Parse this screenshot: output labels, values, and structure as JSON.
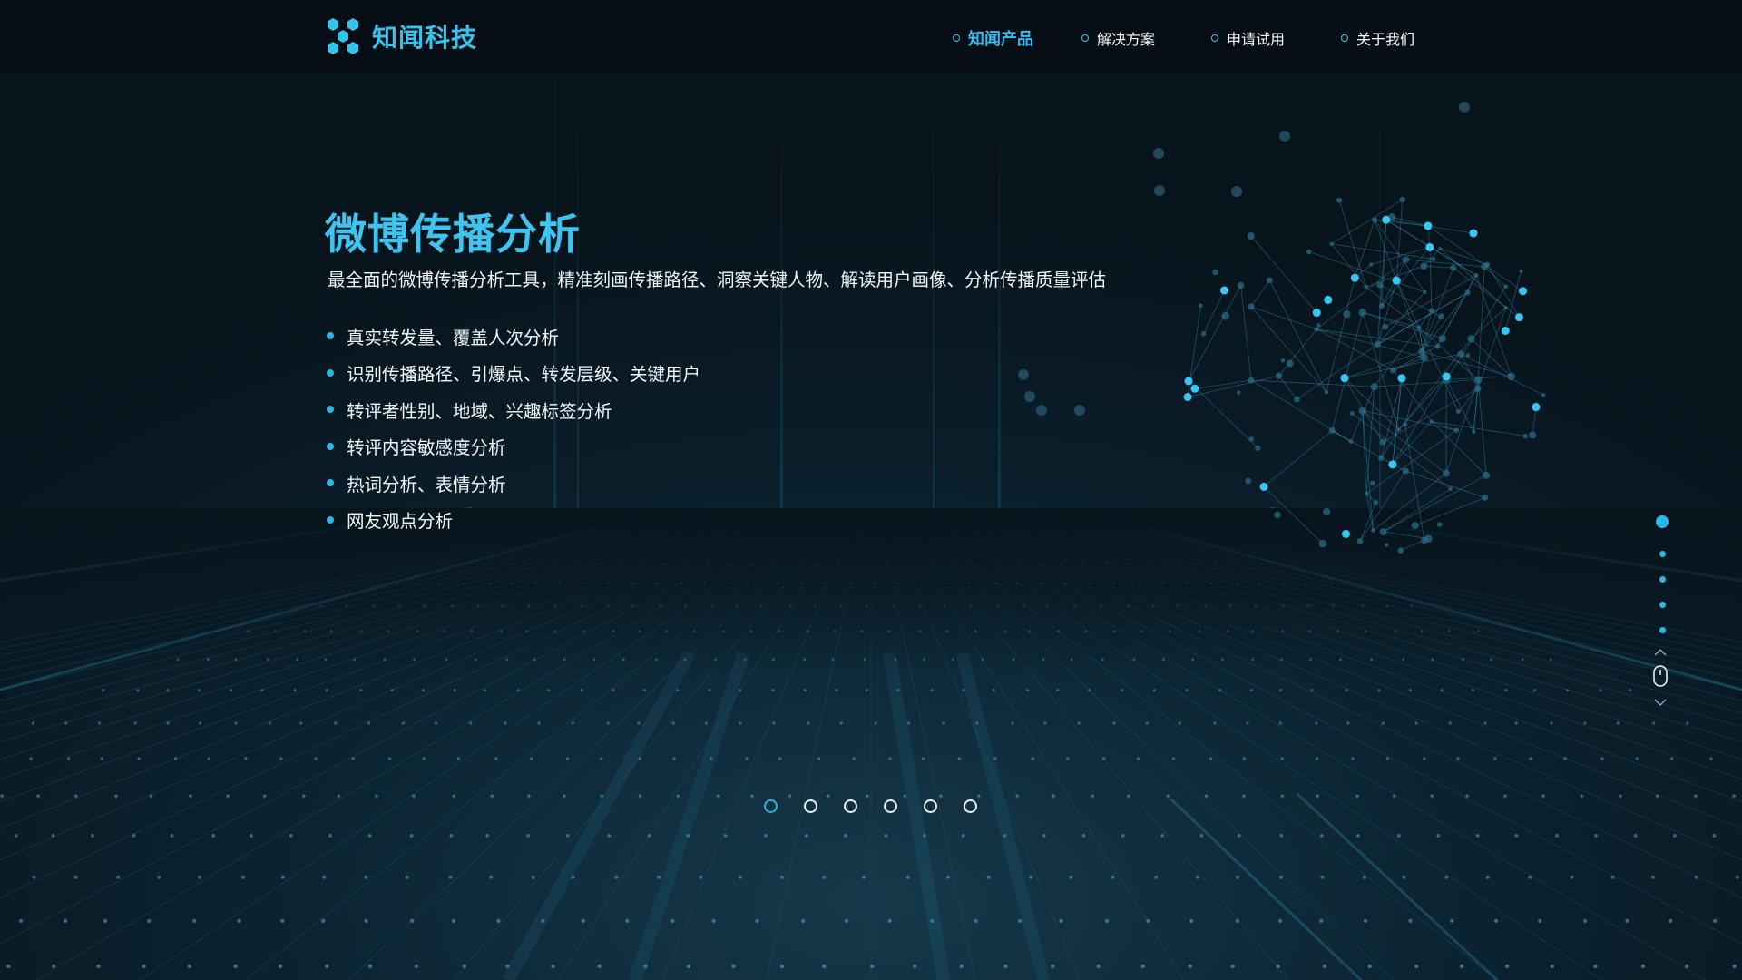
{
  "header": {
    "logo_text": "知闻科技",
    "logo_icon": "hexagon-cluster-icon",
    "nav": [
      {
        "label": "知闻产品",
        "active": true
      },
      {
        "label": "解决方案",
        "active": false
      },
      {
        "label": "申请试用",
        "active": false
      },
      {
        "label": "关于我们",
        "active": false
      }
    ]
  },
  "hero": {
    "title": "微博传播分析",
    "subtitle": "最全面的微博传播分析工具，精准刻画传播路径、洞察关键人物、解读用户画像、分析传播质量评估",
    "features": [
      "真实转发量、覆盖人次分析",
      "识别传播路径、引爆点、转发层级、关键用户",
      "转评者性别、地域、兴趣标签分析",
      "转评内容敏感度分析",
      "热词分析、表情分析",
      "网友观点分析"
    ]
  },
  "carousel": {
    "slide_count": 6,
    "active_index": 0
  },
  "side_nav": {
    "section_count": 5,
    "active_index": 0,
    "scroll_icon": "mouse-scroll-icon"
  },
  "colors": {
    "accent": "#36c4ec",
    "background": "#07141c",
    "topbar": "#060e14",
    "text": "#ffffff"
  }
}
